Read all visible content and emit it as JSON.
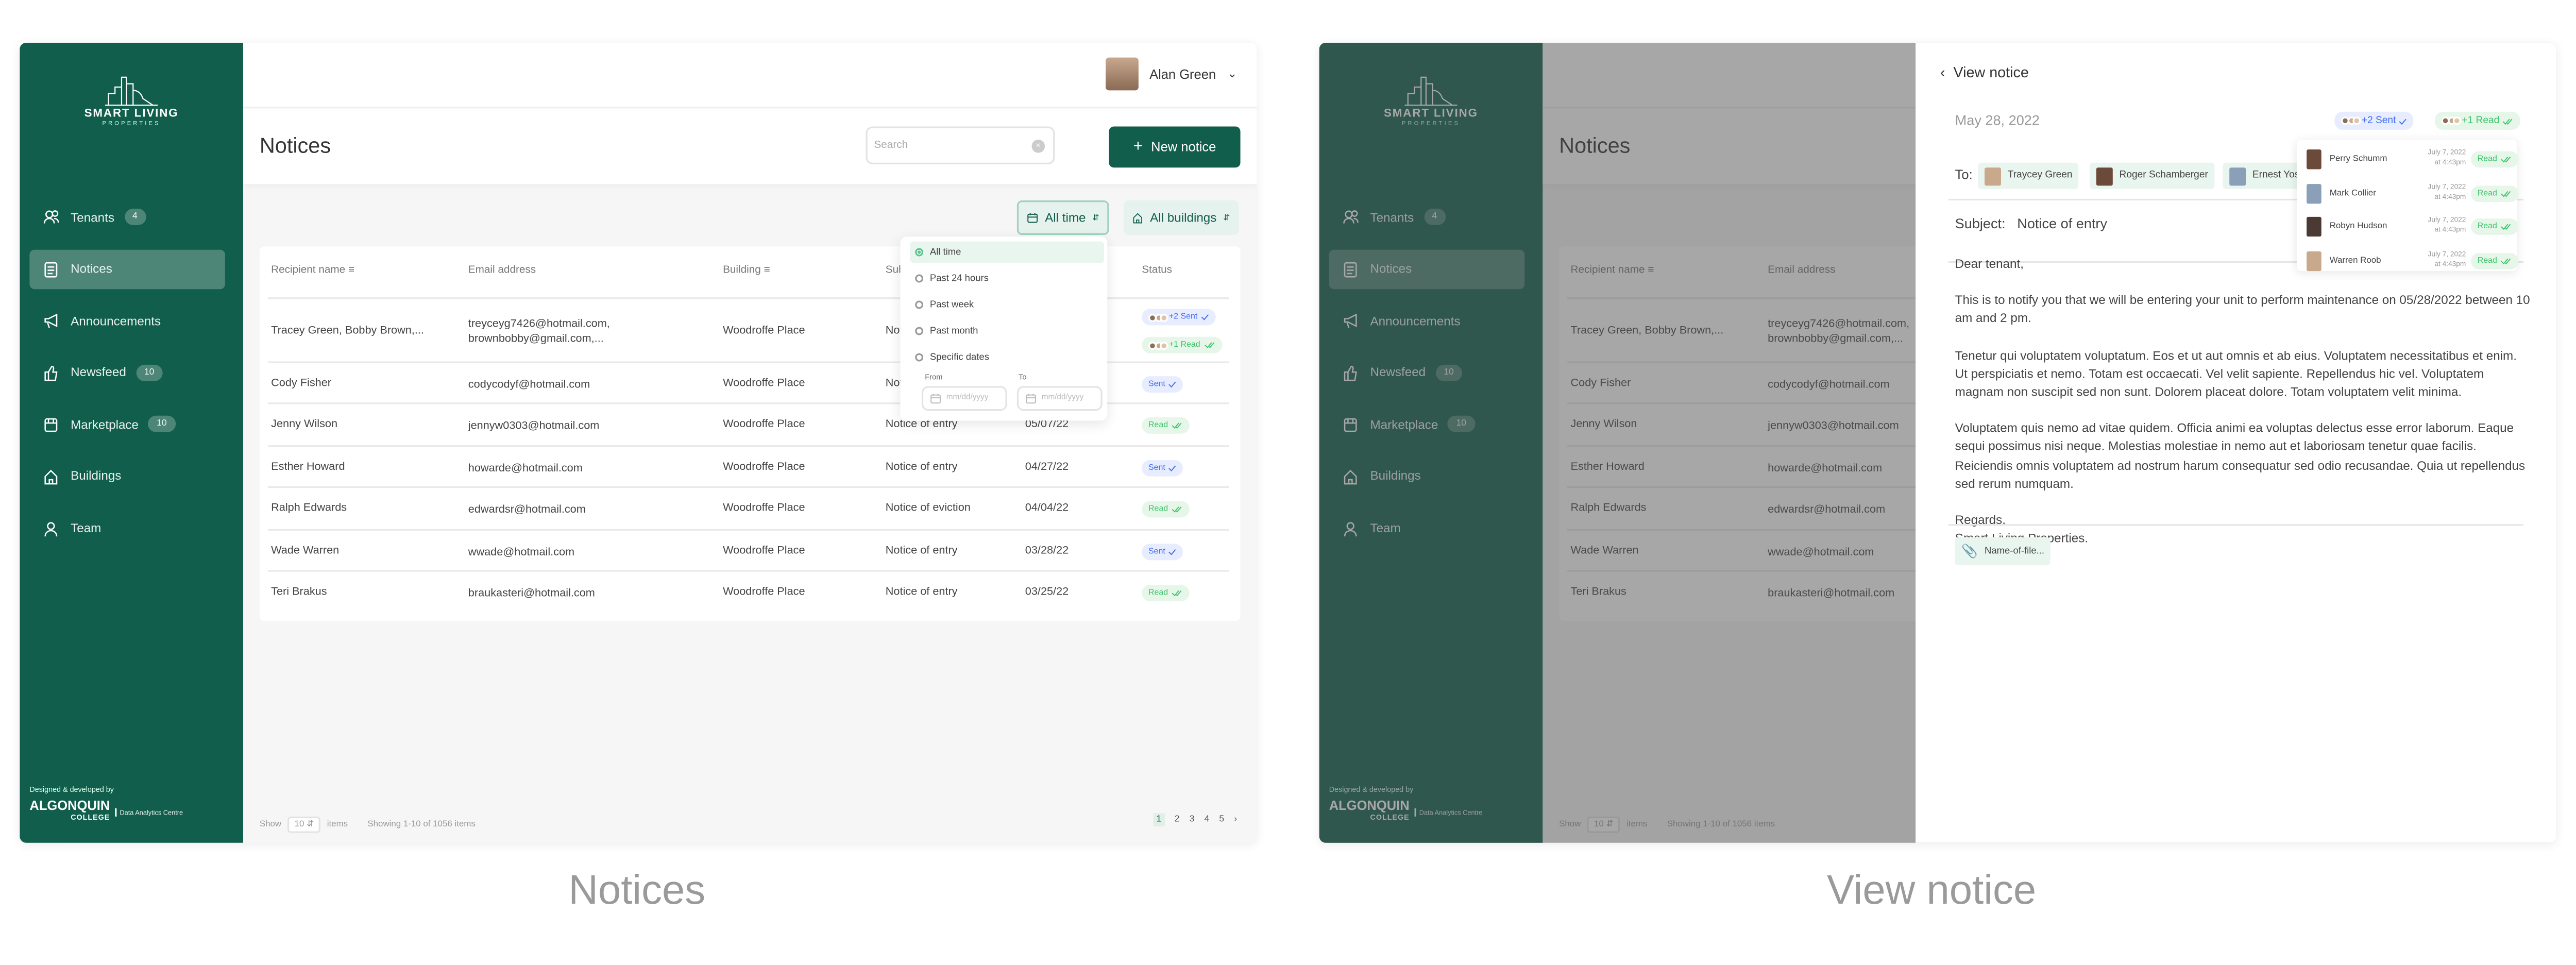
{
  "captions": {
    "left": "Notices",
    "right": "View notice"
  },
  "brand": {
    "name": "SMART LIVING",
    "sub": "PROPERTIES",
    "credit": "Designed & developed by",
    "college": "ALGONQUIN",
    "college_sub": "COLLEGE",
    "centre": "Data Analytics Centre",
    "color": "#105e4b"
  },
  "sidebar": {
    "items": [
      {
        "label": "Tenants",
        "badge": "4",
        "icon": "users-icon"
      },
      {
        "label": "Notices",
        "icon": "document-icon",
        "active": true
      },
      {
        "label": "Announcements",
        "icon": "megaphone-icon"
      },
      {
        "label": "Newsfeed",
        "badge": "10",
        "icon": "thumbs-up-icon"
      },
      {
        "label": "Marketplace",
        "badge": "10",
        "icon": "store-icon"
      },
      {
        "label": "Buildings",
        "icon": "home-icon"
      },
      {
        "label": "Team",
        "icon": "user-icon"
      }
    ]
  },
  "user": {
    "name": "Alan Green"
  },
  "page": {
    "title": "Notices",
    "search_placeholder": "Search",
    "new_notice": "New notice"
  },
  "filters": {
    "time": "All time",
    "building": "All buildings",
    "time_options": [
      "All time",
      "Past 24 hours",
      "Past week",
      "Past month",
      "Specific dates"
    ],
    "from_label": "From",
    "to_label": "To",
    "date_placeholder": "mm/dd/yyyy"
  },
  "table": {
    "headers": [
      "Recipient name",
      "Email address",
      "Building",
      "Subject",
      "",
      "Status"
    ],
    "rows": [
      {
        "name": "Tracey Green, Bobby Brown,...",
        "email": "treyceyg7426@hotmail.com,",
        "email2": "brownbobby@gmail.com,...",
        "building": "Woodroffe Place",
        "subject": "Notice of entry",
        "date": "",
        "status": [
          "+2 Sent",
          "+1 Read"
        ]
      },
      {
        "name": "Cody Fisher",
        "email": "codycodyf@hotmail.com",
        "building": "Woodroffe Place",
        "subject": "Notice of entry",
        "date": "",
        "status": [
          "Sent"
        ]
      },
      {
        "name": "Jenny Wilson",
        "email": "jennyw0303@hotmail.com",
        "building": "Woodroffe Place",
        "subject": "Notice of entry",
        "date": "05/07/22",
        "status": [
          "Read"
        ]
      },
      {
        "name": "Esther Howard",
        "email": "howarde@hotmail.com",
        "building": "Woodroffe Place",
        "subject": "Notice of entry",
        "date": "04/27/22",
        "status": [
          "Sent"
        ]
      },
      {
        "name": "Ralph Edwards",
        "email": "edwardsr@hotmail.com",
        "building": "Woodroffe Place",
        "subject": "Notice of eviction",
        "date": "04/04/22",
        "status": [
          "Read"
        ]
      },
      {
        "name": "Wade Warren",
        "email": "wwade@hotmail.com",
        "building": "Woodroffe Place",
        "subject": "Notice of entry",
        "date": "03/28/22",
        "status": [
          "Sent"
        ]
      },
      {
        "name": "Teri Brakus",
        "email": "braukasteri@hotmail.com",
        "building": "Woodroffe Place",
        "subject": "Notice of entry",
        "date": "03/25/22",
        "status": [
          "Read"
        ]
      }
    ]
  },
  "pagination": {
    "show": "Show",
    "per_page": "10",
    "items": "items",
    "summary": "Showing 1-10 of 1056 items",
    "pages": [
      "1",
      "2",
      "3",
      "4",
      "5"
    ],
    "current": "1"
  },
  "colors": {
    "sent_bg": "#e7ecff",
    "sent_text": "#3e6ef2",
    "read_bg": "#e6f7ea",
    "read_text": "#3ec46a"
  },
  "notice": {
    "back": "View notice",
    "date": "May 28, 2022",
    "sent": "+2 Sent",
    "read": "+1 Read",
    "to_label": "To:",
    "recipients": [
      "Traycey Green",
      "Roger Schamberger",
      "Ernest Yost"
    ],
    "subject_label": "Subject:",
    "subject": "Notice of entry",
    "body": [
      "Dear tenant,",
      "This is to notify you that we will be entering your unit to perform maintenance on 05/28/2022 between 10 am and 2 pm.",
      "Tenetur qui voluptatem voluptatum. Eos et ut aut omnis et ab eius. Voluptatem necessitatibus et enim. Ut perspiciatis et nemo. Totam est occaecati. Vel velit sapiente. Repellendus hic vel. Voluptatem magnam non suscipit sed non sunt. Dolorem placeat dolore. Totam voluptatem velit minima.",
      "Voluptatem quis nemo ad vitae quidem. Officia animi ea voluptas delectus esse error laborum. Eaque sequi possimus nisi neque. Molestias molestiae in nemo aut et laboriosam tenetur quae facilis. Reiciendis omnis voluptatem ad nostrum harum consequatur sed odio recusandae. Quia ut repellendus sed rerum numquam.",
      "Regards,",
      "Smart Living Properties."
    ],
    "attachment": "Name-of-file...",
    "read_by": [
      {
        "name": "Perry Schumm",
        "date": "July 7, 2022",
        "time": "at 4:43pm",
        "status": "Read"
      },
      {
        "name": "Mark Collier",
        "date": "July 7, 2022",
        "time": "at 4:43pm",
        "status": "Read"
      },
      {
        "name": "Robyn Hudson",
        "date": "July 7, 2022",
        "time": "at 4:43pm",
        "status": "Read"
      },
      {
        "name": "Warren Roob",
        "date": "July 7, 2022",
        "time": "at 4:43pm",
        "status": "Read"
      }
    ]
  }
}
